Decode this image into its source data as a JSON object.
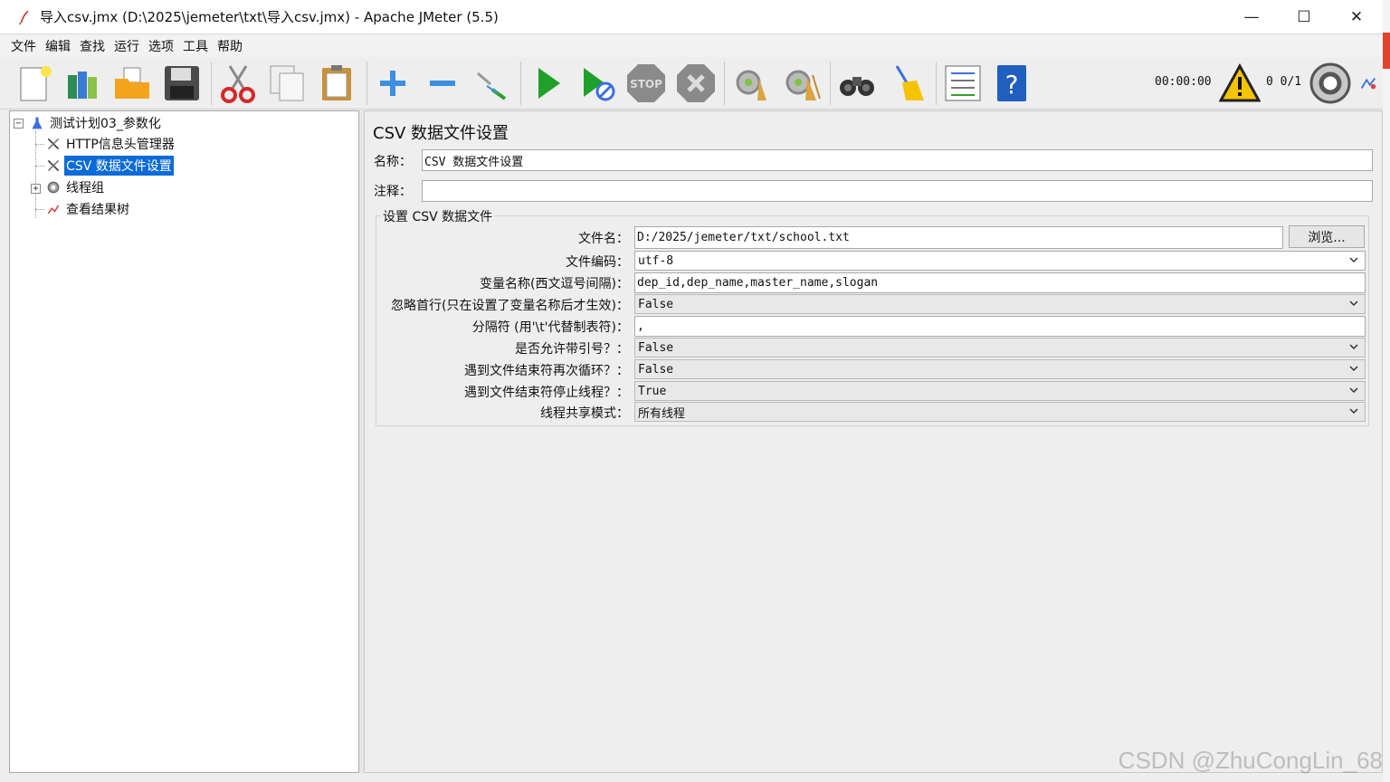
{
  "window": {
    "title": "导入csv.jmx (D:\\2025\\jemeter\\txt\\导入csv.jmx) - Apache JMeter (5.5)",
    "minimize": "—",
    "maximize": "☐",
    "close": "✕"
  },
  "menu": [
    "文件",
    "编辑",
    "查找",
    "运行",
    "选项",
    "工具",
    "帮助"
  ],
  "toolbar": {
    "stop_label": "STOP",
    "timer": "00:00:00",
    "warning_count": "0",
    "threads": "0/1"
  },
  "tree": {
    "root": "测试计划03_参数化",
    "items": [
      "HTTP信息头管理器",
      "CSV 数据文件设置",
      "线程组",
      "查看结果树"
    ],
    "selected_index": 1
  },
  "panel": {
    "title": "CSV 数据文件设置",
    "name_label": "名称：",
    "name_value": "CSV 数据文件设置",
    "comment_label": "注释：",
    "comment_value": "",
    "group_title": "设置 CSV 数据文件",
    "browse_label": "浏览...",
    "rows": [
      {
        "label": "文件名：",
        "value": "D:/2025/jemeter/txt/school.txt",
        "kind": "text"
      },
      {
        "label": "文件编码：",
        "value": "utf-8",
        "kind": "combo-white"
      },
      {
        "label": "变量名称(西文逗号间隔)：",
        "value": "dep_id,dep_name,master_name,slogan",
        "kind": "text"
      },
      {
        "label": "忽略首行(只在设置了变量名称后才生效)：",
        "value": "False",
        "kind": "combo"
      },
      {
        "label": "分隔符 (用'\\t'代替制表符)：",
        "value": ",",
        "kind": "text"
      },
      {
        "label": "是否允许带引号？：",
        "value": "False",
        "kind": "combo"
      },
      {
        "label": "遇到文件结束符再次循环？：",
        "value": "False",
        "kind": "combo"
      },
      {
        "label": "遇到文件结束符停止线程？：",
        "value": "True",
        "kind": "combo"
      },
      {
        "label": "线程共享模式：",
        "value": "所有线程",
        "kind": "combo"
      }
    ]
  },
  "watermark": "CSDN @ZhuCongLin_68",
  "colors": {
    "selection": "#0b6bd8",
    "start_green": "#1fa02a",
    "stop_gray": "#8a8a8a",
    "warning_yellow": "#f5c400"
  }
}
